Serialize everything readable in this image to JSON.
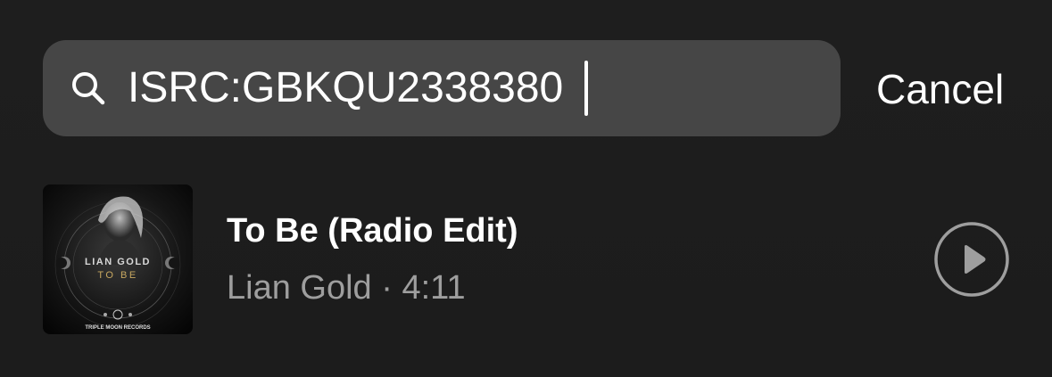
{
  "search": {
    "value": "ISRC:GBKQU2338380",
    "icon": "search-icon",
    "cancel_label": "Cancel"
  },
  "results": [
    {
      "title": "To Be (Radio Edit)",
      "artist": "Lian Gold",
      "separator": "·",
      "duration": "4:11",
      "artwork": {
        "artist_text": "LIAN GOLD",
        "title_text": "TO BE",
        "label_text": "TRIPLE MOON RECORDS"
      },
      "play_icon": "play-circle-icon"
    }
  ],
  "colors": {
    "background": "#1e1e1e",
    "search_field": "#464646",
    "primary_text": "#ffffff",
    "secondary_text": "#9e9e9e",
    "accent": "#c8a860"
  }
}
